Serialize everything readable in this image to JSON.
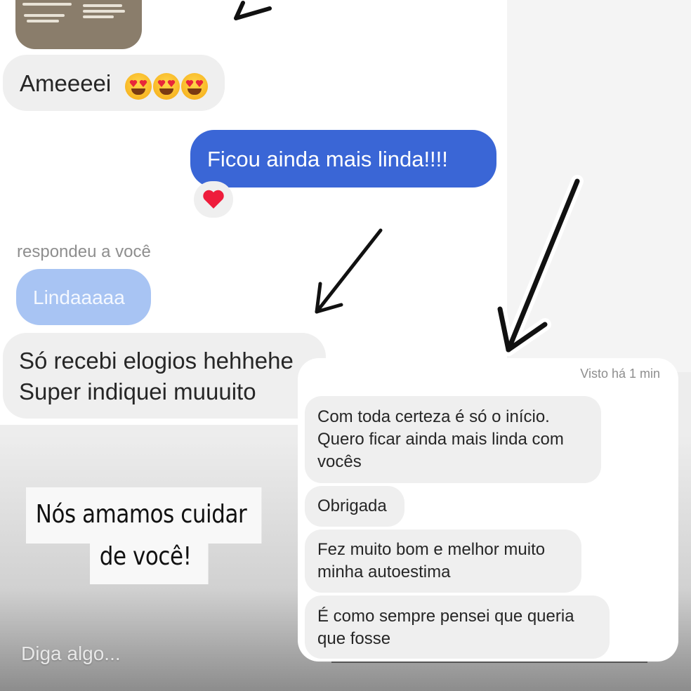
{
  "chat1": {
    "msg_ameeeei": "Ameeeei",
    "msg_sent": "Ficou ainda mais linda!!!!",
    "reply_label": "respondeu a você",
    "reply_quote": "Lindaaaaa",
    "msg_elogios_line1": "Só recebi elogios hehhehe",
    "msg_elogios_line2": "Super indiquei muuuito"
  },
  "chat2": {
    "seen_status": "Visto há 1 min",
    "messages": [
      "Com toda certeza é só o início. Quero ficar ainda mais linda com vocês",
      "Obrigada",
      "Fez muito bom e melhor muito minha autoestima",
      "É como sempre pensei que queria que fosse"
    ]
  },
  "caption": {
    "line1": "Nós amamos cuidar",
    "line2": "de você!"
  },
  "story_input": {
    "placeholder": "Diga algo..."
  },
  "colors": {
    "sent_bubble": "#3a66d6",
    "quote_bubble": "#a8c4f3",
    "received_bubble": "#efefef"
  }
}
